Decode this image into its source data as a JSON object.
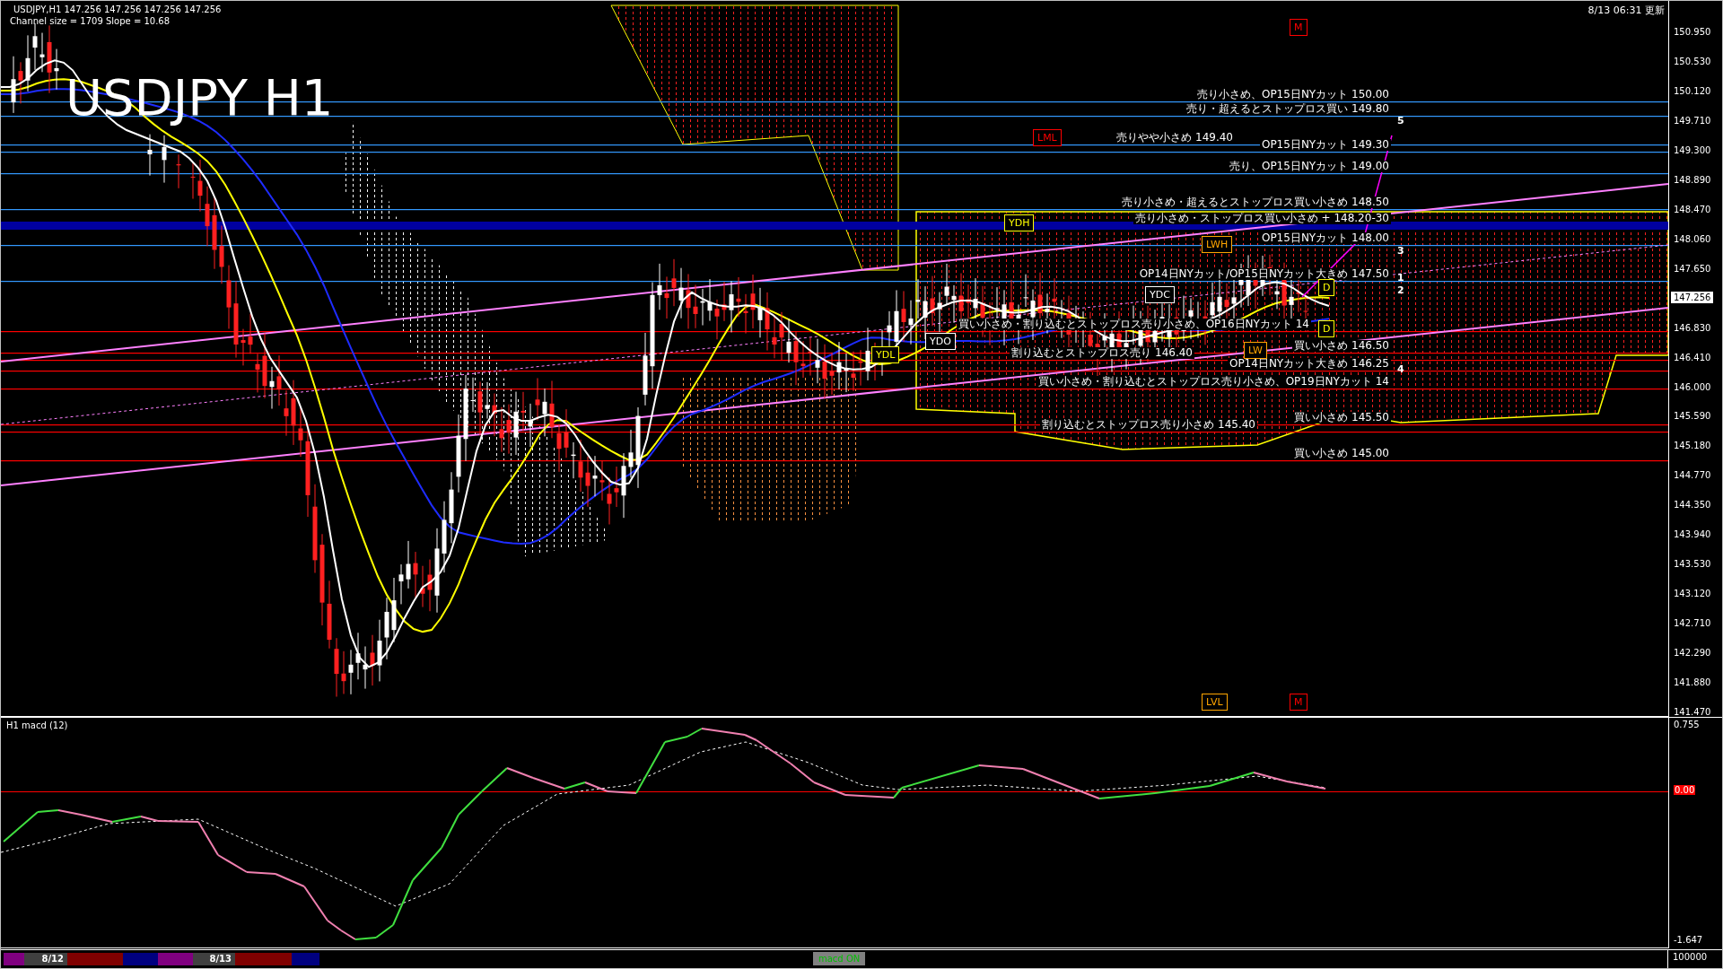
{
  "header": {
    "symbol_line": "USDJPY,H1  147.256 147.256 147.256 147.256",
    "channel_info": "Channel size = 1709 Slope = 10.68",
    "updated": "8/13 06:31 更新"
  },
  "chart_title": "USDJPY H1",
  "price_axis": {
    "ticks": [
      "150.950",
      "150.530",
      "150.120",
      "149.710",
      "149.300",
      "148.890",
      "148.470",
      "148.060",
      "147.650",
      "146.830",
      "146.410",
      "146.000",
      "145.590",
      "145.180",
      "144.770",
      "144.350",
      "143.940",
      "143.530",
      "143.120",
      "142.710",
      "142.290",
      "141.880",
      "141.470"
    ],
    "current_price": "147.256"
  },
  "levels": [
    {
      "text": "売り小さめ、OP15日NYカット 150.00",
      "kind": "line",
      "color": "#3399ff"
    },
    {
      "text": "売り・超えるとストップロス買い 149.80",
      "kind": "line",
      "color": "#3399ff"
    },
    {
      "text": "売りやや小さめ 149.40",
      "kind": "line",
      "color": "#3399ff"
    },
    {
      "text": "OP15日NYカット 149.30",
      "kind": "line",
      "color": "#3399ff"
    },
    {
      "text": "売り、OP15日NYカット 149.00",
      "kind": "line",
      "color": "#3399ff"
    },
    {
      "text": "売り小さめ・超えるとストップロス買い小さめ 148.50",
      "kind": "line",
      "color": "#3399ff"
    },
    {
      "text": "売り小さめ・ストップロス買い小さめ + 148.20-30",
      "kind": "band",
      "color": "#0000a0"
    },
    {
      "text": "OP15日NYカット 148.00",
      "kind": "line",
      "color": "#3399ff"
    },
    {
      "text": "OP14日NYカット/OP15日NYカット大きめ 147.50",
      "kind": "line",
      "color": "#3399ff"
    },
    {
      "text": "買い小さめ・割り込むとストップロス売り小さめ、OP16日NYカット 14",
      "kind": "line",
      "color": "#ff0000"
    },
    {
      "text": "買い小さめ 146.50",
      "kind": "line",
      "color": "#ff0000"
    },
    {
      "text": "割り込むとストップロス売り 146.40",
      "kind": "line",
      "color": "#ff0000"
    },
    {
      "text": "OP14日NYカット大きめ 146.25",
      "kind": "line",
      "color": "#ff0000"
    },
    {
      "text": "買い小さめ・割り込むとストップロス売り小さめ、OP19日NYカット 14",
      "kind": "line",
      "color": "#ff0000"
    },
    {
      "text": "買い小さめ 145.50",
      "kind": "line",
      "color": "#ff0000"
    },
    {
      "text": "割り込むとストップロス売り小さめ 145.40",
      "kind": "line",
      "color": "#ff0000"
    },
    {
      "text": "買い小さめ 145.00",
      "kind": "line",
      "color": "#ff0000"
    }
  ],
  "markers": [
    {
      "text": "M",
      "color": "#ff0000"
    },
    {
      "text": "LML",
      "color": "#ff0000"
    },
    {
      "text": "YDH",
      "color": "#ffff00"
    },
    {
      "text": "LWH",
      "color": "#ffa500"
    },
    {
      "text": "YDC",
      "color": "#ffffff"
    },
    {
      "text": "YDO",
      "color": "#ffffff"
    },
    {
      "text": "D",
      "color": "#ffff00"
    },
    {
      "text": "D",
      "color": "#ffff00"
    },
    {
      "text": "YDL",
      "color": "#ffff00"
    },
    {
      "text": "LW",
      "color": "#ffa500"
    },
    {
      "text": "LVL",
      "color": "#ffa500"
    },
    {
      "text": "M",
      "color": "#ff0000"
    }
  ],
  "wave_labels": [
    "5",
    "3",
    "1",
    "2",
    "4"
  ],
  "macd": {
    "title": "H1  macd (12)",
    "axis": [
      "0.755",
      "0.00",
      "-1.647"
    ]
  },
  "volume_axis": "100000",
  "session_bar": {
    "segments": [
      {
        "color": "#800080"
      },
      {
        "label": "8/12",
        "color": "#404040"
      },
      {
        "color": "#800000"
      },
      {
        "color": "#000080"
      },
      {
        "color": "#800080"
      },
      {
        "label": "8/13",
        "color": "#404040"
      },
      {
        "color": "#800000"
      },
      {
        "color": "#000080"
      }
    ],
    "toggle": "macd ON"
  }
}
